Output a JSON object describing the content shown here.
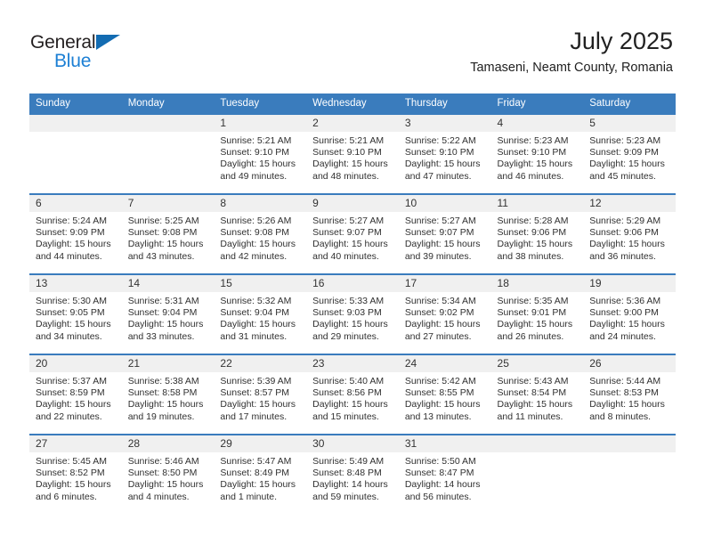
{
  "brand": {
    "name_top": "General",
    "name_bottom": "Blue",
    "accent_color": "#1c7fd4",
    "triangle_color": "#136cb2"
  },
  "header": {
    "title": "July 2025",
    "subtitle": "Tamaseni, Neamt County, Romania"
  },
  "calendar": {
    "header_bg": "#3a7cbd",
    "daynum_bg": "#f0f0f0",
    "weekdays": [
      "Sunday",
      "Monday",
      "Tuesday",
      "Wednesday",
      "Thursday",
      "Friday",
      "Saturday"
    ],
    "weeks": [
      [
        {
          "day": "",
          "sunrise": "",
          "sunset": "",
          "daylight": ""
        },
        {
          "day": "",
          "sunrise": "",
          "sunset": "",
          "daylight": ""
        },
        {
          "day": "1",
          "sunrise": "Sunrise: 5:21 AM",
          "sunset": "Sunset: 9:10 PM",
          "daylight": "Daylight: 15 hours and 49 minutes."
        },
        {
          "day": "2",
          "sunrise": "Sunrise: 5:21 AM",
          "sunset": "Sunset: 9:10 PM",
          "daylight": "Daylight: 15 hours and 48 minutes."
        },
        {
          "day": "3",
          "sunrise": "Sunrise: 5:22 AM",
          "sunset": "Sunset: 9:10 PM",
          "daylight": "Daylight: 15 hours and 47 minutes."
        },
        {
          "day": "4",
          "sunrise": "Sunrise: 5:23 AM",
          "sunset": "Sunset: 9:10 PM",
          "daylight": "Daylight: 15 hours and 46 minutes."
        },
        {
          "day": "5",
          "sunrise": "Sunrise: 5:23 AM",
          "sunset": "Sunset: 9:09 PM",
          "daylight": "Daylight: 15 hours and 45 minutes."
        }
      ],
      [
        {
          "day": "6",
          "sunrise": "Sunrise: 5:24 AM",
          "sunset": "Sunset: 9:09 PM",
          "daylight": "Daylight: 15 hours and 44 minutes."
        },
        {
          "day": "7",
          "sunrise": "Sunrise: 5:25 AM",
          "sunset": "Sunset: 9:08 PM",
          "daylight": "Daylight: 15 hours and 43 minutes."
        },
        {
          "day": "8",
          "sunrise": "Sunrise: 5:26 AM",
          "sunset": "Sunset: 9:08 PM",
          "daylight": "Daylight: 15 hours and 42 minutes."
        },
        {
          "day": "9",
          "sunrise": "Sunrise: 5:27 AM",
          "sunset": "Sunset: 9:07 PM",
          "daylight": "Daylight: 15 hours and 40 minutes."
        },
        {
          "day": "10",
          "sunrise": "Sunrise: 5:27 AM",
          "sunset": "Sunset: 9:07 PM",
          "daylight": "Daylight: 15 hours and 39 minutes."
        },
        {
          "day": "11",
          "sunrise": "Sunrise: 5:28 AM",
          "sunset": "Sunset: 9:06 PM",
          "daylight": "Daylight: 15 hours and 38 minutes."
        },
        {
          "day": "12",
          "sunrise": "Sunrise: 5:29 AM",
          "sunset": "Sunset: 9:06 PM",
          "daylight": "Daylight: 15 hours and 36 minutes."
        }
      ],
      [
        {
          "day": "13",
          "sunrise": "Sunrise: 5:30 AM",
          "sunset": "Sunset: 9:05 PM",
          "daylight": "Daylight: 15 hours and 34 minutes."
        },
        {
          "day": "14",
          "sunrise": "Sunrise: 5:31 AM",
          "sunset": "Sunset: 9:04 PM",
          "daylight": "Daylight: 15 hours and 33 minutes."
        },
        {
          "day": "15",
          "sunrise": "Sunrise: 5:32 AM",
          "sunset": "Sunset: 9:04 PM",
          "daylight": "Daylight: 15 hours and 31 minutes."
        },
        {
          "day": "16",
          "sunrise": "Sunrise: 5:33 AM",
          "sunset": "Sunset: 9:03 PM",
          "daylight": "Daylight: 15 hours and 29 minutes."
        },
        {
          "day": "17",
          "sunrise": "Sunrise: 5:34 AM",
          "sunset": "Sunset: 9:02 PM",
          "daylight": "Daylight: 15 hours and 27 minutes."
        },
        {
          "day": "18",
          "sunrise": "Sunrise: 5:35 AM",
          "sunset": "Sunset: 9:01 PM",
          "daylight": "Daylight: 15 hours and 26 minutes."
        },
        {
          "day": "19",
          "sunrise": "Sunrise: 5:36 AM",
          "sunset": "Sunset: 9:00 PM",
          "daylight": "Daylight: 15 hours and 24 minutes."
        }
      ],
      [
        {
          "day": "20",
          "sunrise": "Sunrise: 5:37 AM",
          "sunset": "Sunset: 8:59 PM",
          "daylight": "Daylight: 15 hours and 22 minutes."
        },
        {
          "day": "21",
          "sunrise": "Sunrise: 5:38 AM",
          "sunset": "Sunset: 8:58 PM",
          "daylight": "Daylight: 15 hours and 19 minutes."
        },
        {
          "day": "22",
          "sunrise": "Sunrise: 5:39 AM",
          "sunset": "Sunset: 8:57 PM",
          "daylight": "Daylight: 15 hours and 17 minutes."
        },
        {
          "day": "23",
          "sunrise": "Sunrise: 5:40 AM",
          "sunset": "Sunset: 8:56 PM",
          "daylight": "Daylight: 15 hours and 15 minutes."
        },
        {
          "day": "24",
          "sunrise": "Sunrise: 5:42 AM",
          "sunset": "Sunset: 8:55 PM",
          "daylight": "Daylight: 15 hours and 13 minutes."
        },
        {
          "day": "25",
          "sunrise": "Sunrise: 5:43 AM",
          "sunset": "Sunset: 8:54 PM",
          "daylight": "Daylight: 15 hours and 11 minutes."
        },
        {
          "day": "26",
          "sunrise": "Sunrise: 5:44 AM",
          "sunset": "Sunset: 8:53 PM",
          "daylight": "Daylight: 15 hours and 8 minutes."
        }
      ],
      [
        {
          "day": "27",
          "sunrise": "Sunrise: 5:45 AM",
          "sunset": "Sunset: 8:52 PM",
          "daylight": "Daylight: 15 hours and 6 minutes."
        },
        {
          "day": "28",
          "sunrise": "Sunrise: 5:46 AM",
          "sunset": "Sunset: 8:50 PM",
          "daylight": "Daylight: 15 hours and 4 minutes."
        },
        {
          "day": "29",
          "sunrise": "Sunrise: 5:47 AM",
          "sunset": "Sunset: 8:49 PM",
          "daylight": "Daylight: 15 hours and 1 minute."
        },
        {
          "day": "30",
          "sunrise": "Sunrise: 5:49 AM",
          "sunset": "Sunset: 8:48 PM",
          "daylight": "Daylight: 14 hours and 59 minutes."
        },
        {
          "day": "31",
          "sunrise": "Sunrise: 5:50 AM",
          "sunset": "Sunset: 8:47 PM",
          "daylight": "Daylight: 14 hours and 56 minutes."
        },
        {
          "day": "",
          "sunrise": "",
          "sunset": "",
          "daylight": ""
        },
        {
          "day": "",
          "sunrise": "",
          "sunset": "",
          "daylight": ""
        }
      ]
    ]
  }
}
